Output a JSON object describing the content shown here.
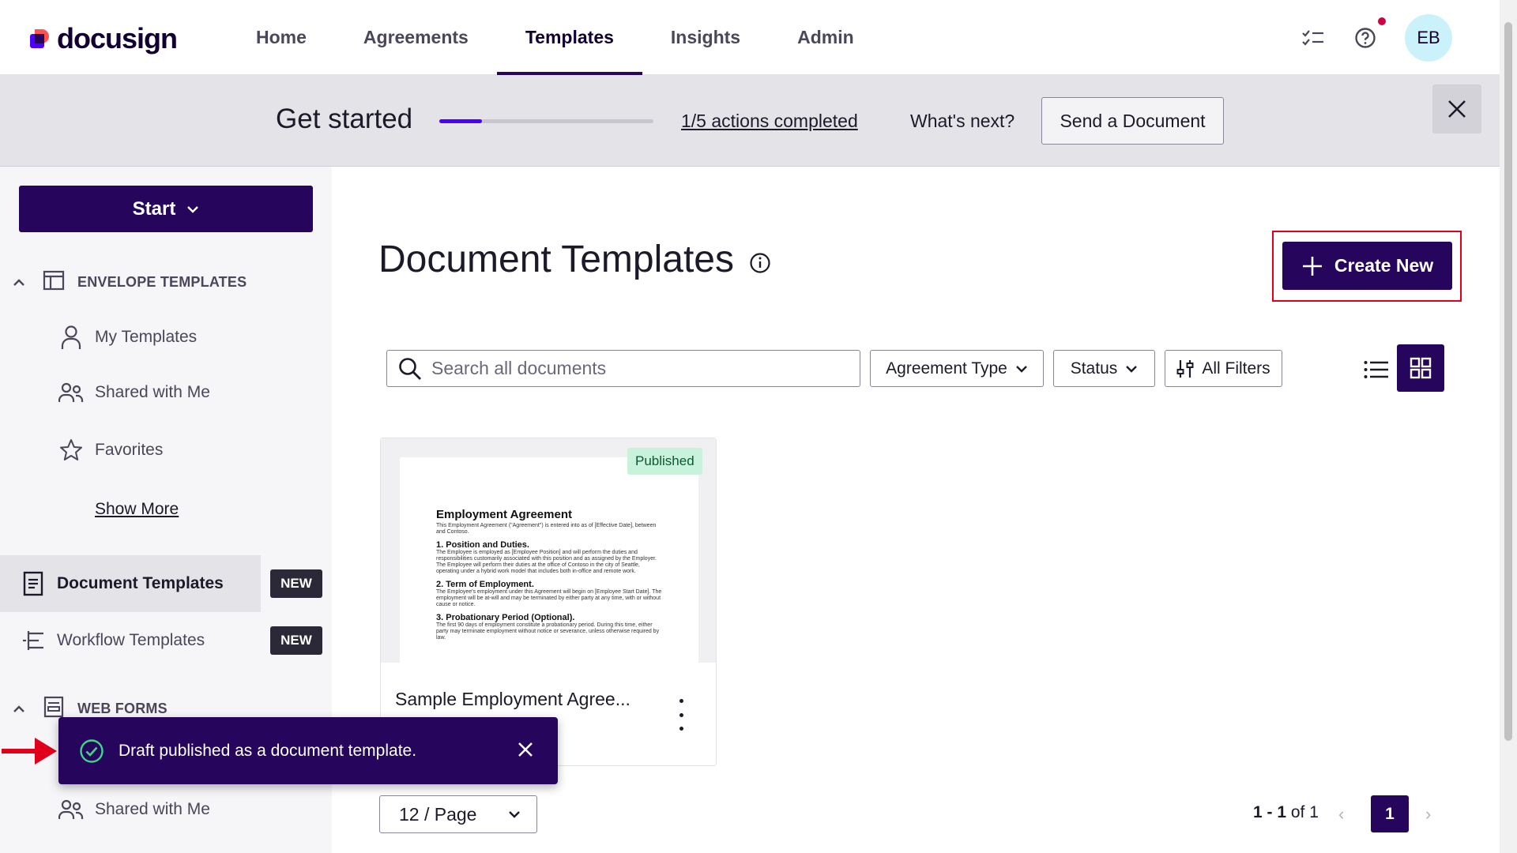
{
  "app": {
    "logo_text": "docusign"
  },
  "nav": {
    "items": [
      {
        "label": "Home"
      },
      {
        "label": "Agreements"
      },
      {
        "label": "Templates",
        "active": true
      },
      {
        "label": "Insights"
      },
      {
        "label": "Admin"
      }
    ]
  },
  "topbar": {
    "avatar_initials": "EB",
    "icons": [
      "tasks-icon",
      "help-icon"
    ]
  },
  "banner": {
    "title": "Get started",
    "progress_fraction": 0.2,
    "progress_link": "1/5 actions completed",
    "next_label": "What's next?",
    "action_button": "Send a Document"
  },
  "sidebar": {
    "start_label": "Start",
    "envelope_header": "ENVELOPE TEMPLATES",
    "envelope_items": [
      {
        "label": "My Templates",
        "icon": "person-icon"
      },
      {
        "label": "Shared with Me",
        "icon": "people-icon"
      },
      {
        "label": "Favorites",
        "icon": "star-icon"
      }
    ],
    "show_more": "Show More",
    "document_templates": "Document Templates",
    "workflow_templates": "Workflow Templates",
    "new_badge": "NEW",
    "webforms_header": "WEB FORMS",
    "webforms_shared": "Shared with Me"
  },
  "main": {
    "title": "Document Templates",
    "create_label": "Create New",
    "search_placeholder": "Search all documents",
    "filters": {
      "agreement_type": "Agreement Type",
      "status": "Status",
      "all_filters": "All Filters"
    }
  },
  "card": {
    "badge": "Published",
    "title": "Sample Employment Agree...",
    "preview": {
      "heading": "Employment Agreement",
      "intro": "This Employment Agreement (\"Agreement\") is entered into as of [Effective Date], between and Contoso.",
      "s1_title": "1. Position and Duties.",
      "s1_body": "The Employee is employed as [Employee Position] and will perform the duties and responsibilities customarily associated with this position and as assigned by the Employer. The Employee will perform their duties at the office of Contoso in the city of Seattle, operating under a hybrid work model that includes both in-office and remote work.",
      "s2_title": "2. Term of Employment.",
      "s2_body": "The Employee's employment under this Agreement will begin on [Employee Start Date]. The employment will be at-will and may be terminated by either party at any time, with or without cause or notice.",
      "s3_title": "3. Probationary Period (Optional).",
      "s3_body": "The first 90 days of employment constitute a probationary period. During this time, either party may terminate employment without notice or severance, unless otherwise required by law."
    }
  },
  "pagination": {
    "per_page": "12 / Page",
    "range": "1 - 1",
    "of_label": "of 1",
    "current": "1"
  },
  "toast": {
    "message": "Draft published as a document template."
  },
  "colors": {
    "brand": "#26065d",
    "accent": "#4c00ff",
    "highlight": "#e0001b",
    "published": "#c9f2dd"
  }
}
